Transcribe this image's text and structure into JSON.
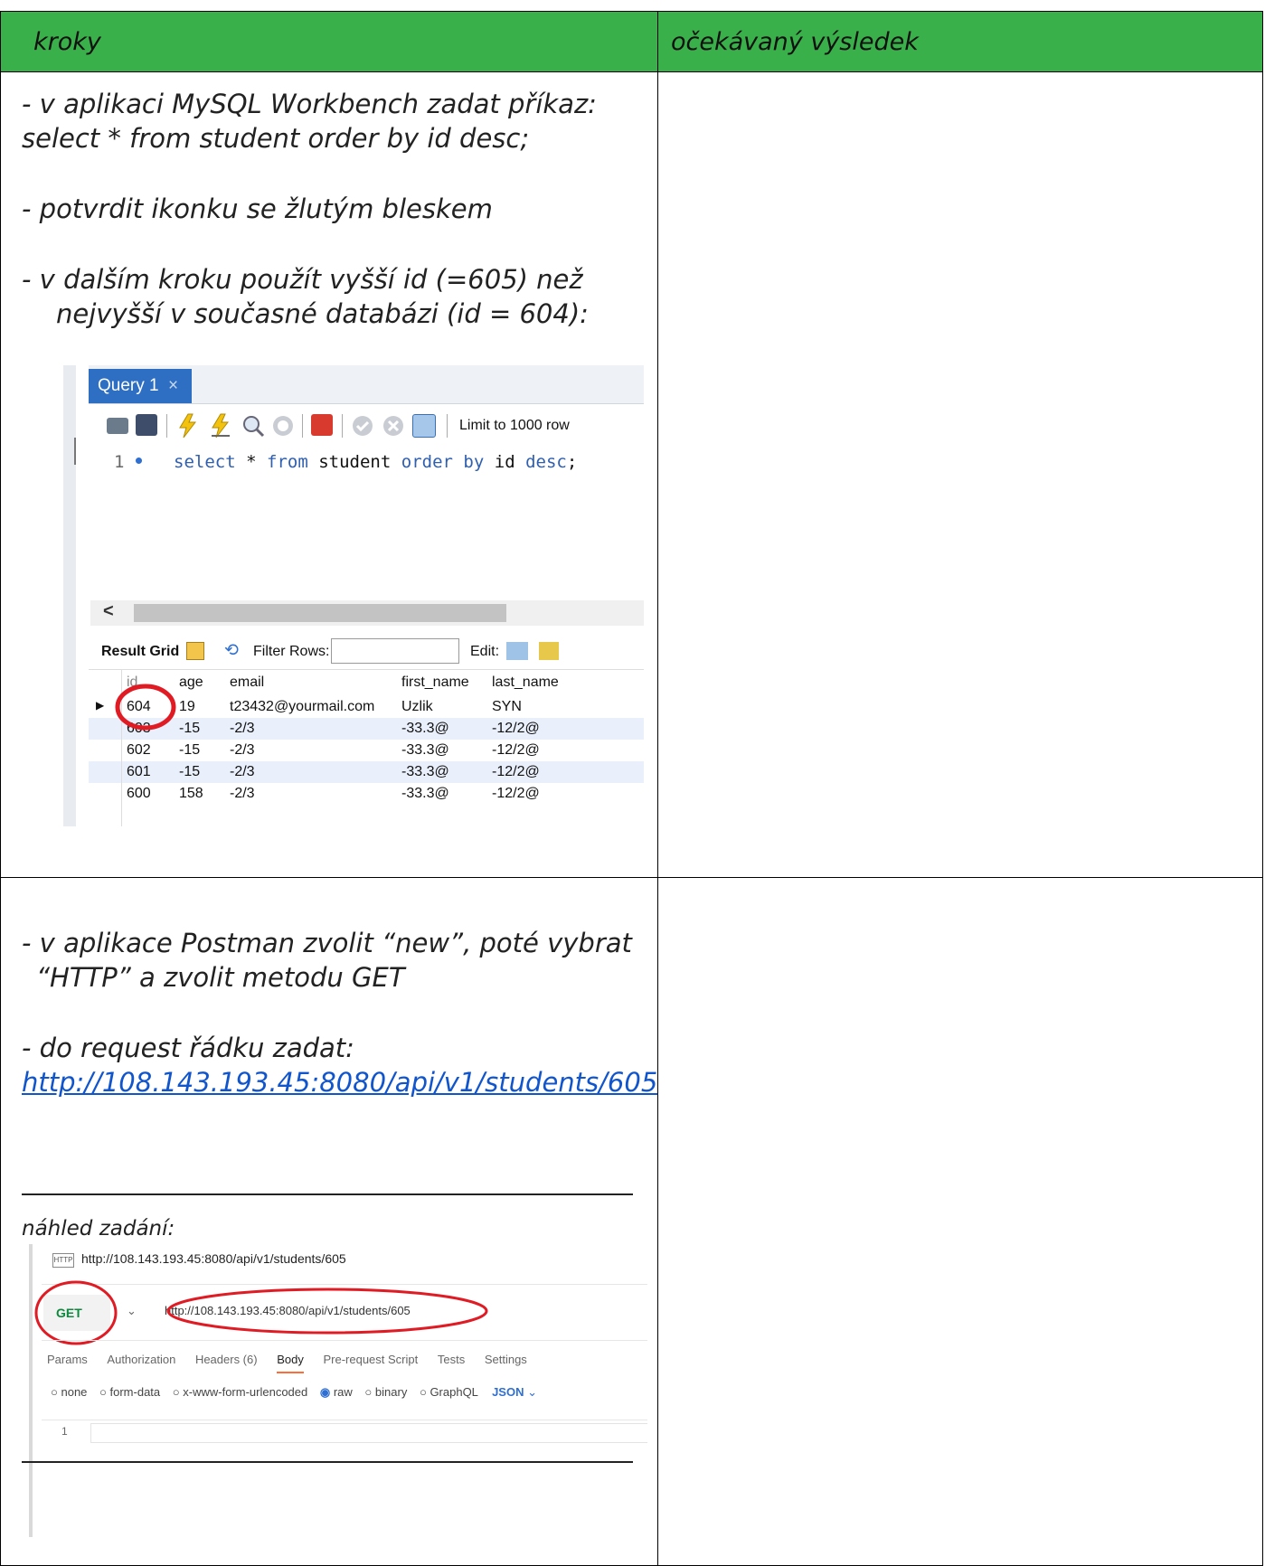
{
  "table": {
    "col1_header": "kroky",
    "col2_header": "očekávaný výsledek"
  },
  "row1": {
    "l1a": "-   v aplikaci MySQL Workbench zadat příkaz:",
    "l1b": "select * from student order by id desc;",
    "l2": "-   potvrdit ikonku se žlutým bleskem",
    "l3a": "-   v dalším kroku použít vyšší id (=605) než",
    "l3b": "nejvyšší v současné databázi (id = 604):"
  },
  "workbench": {
    "tab_label": "Query 1",
    "tab_close": "×",
    "limit_label": "Limit to 1000 row",
    "line_number": "1",
    "sql": {
      "kw_select": "select",
      "star": "*",
      "kw_from": "from",
      "table": "student",
      "kw_order": "order",
      "kw_by": "by",
      "col": "id",
      "kw_desc": "desc",
      "semi": ";"
    },
    "scroll_left": "<",
    "result_grid_label": "Result Grid",
    "filter_rows_label": "Filter Rows:",
    "edit_label": "Edit:",
    "columns": [
      "id",
      "age",
      "email",
      "first_name",
      "last_name"
    ],
    "rows": [
      [
        "604",
        "19",
        "t23432@yourmail.com",
        "Uzlik",
        "SYN"
      ],
      [
        "603",
        "-15",
        "-2/3",
        "-33.3@",
        "-12/2@"
      ],
      [
        "602",
        "-15",
        "-2/3",
        "-33.3@",
        "-12/2@"
      ],
      [
        "601",
        "-15",
        "-2/3",
        "-33.3@",
        "-12/2@"
      ],
      [
        "600",
        "158",
        "-2/3",
        "-33.3@",
        "-12/2@"
      ]
    ],
    "colors": {
      "circle": "#e01b24",
      "tab": "#2e6fc3",
      "keyword": "#2f5fb0"
    }
  },
  "row2": {
    "l1a": "- v aplikace Postman zvolit “new”, poté vybrat",
    "l1b": "“HTTP” a zvolit metodu GET",
    "l2": "- do request řádku zadat:",
    "url": "http://108.143.193.45:8080/api/v1/students/605",
    "preview_label": "náhled zadání:"
  },
  "postman": {
    "http_badge": "HTTP",
    "title": "http://108.143.193.45:8080/api/v1/students/605",
    "method": "GET",
    "request_url": "http://108.143.193.45:8080/api/v1/students/605",
    "tabs": [
      "Params",
      "Authorization",
      "Headers (6)",
      "Body",
      "Pre-request Script",
      "Tests",
      "Settings"
    ],
    "body_options": [
      "none",
      "form-data",
      "x-www-form-urlencoded",
      "raw",
      "binary",
      "GraphQL"
    ],
    "format": "JSON",
    "line_number": "1",
    "colors": {
      "method": "#0b8a3e",
      "active_tab_underline": "#ff6c37",
      "format": "#2f6fd1",
      "circle": "#e01b24"
    }
  }
}
